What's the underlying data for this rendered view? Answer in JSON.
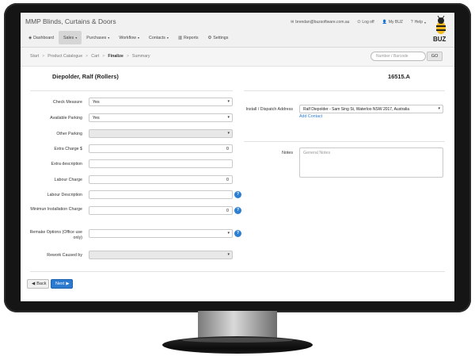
{
  "app": {
    "brand": "MMP Blinds, Curtains & Doors",
    "logo_text": "BUZ"
  },
  "userlinks": [
    {
      "icon": "email-icon",
      "label": "brendan@buzsoftware.com.au"
    },
    {
      "icon": "power-icon",
      "label": "Log off"
    },
    {
      "icon": "user-icon",
      "label": "My BUZ"
    },
    {
      "icon": "question-icon",
      "label": "Help"
    }
  ],
  "nav": [
    {
      "icon": "dashboard-icon",
      "label": "Dashboard",
      "caret": false
    },
    {
      "icon": "",
      "label": "Sales",
      "caret": true
    },
    {
      "icon": "",
      "label": "Purchases",
      "caret": true
    },
    {
      "icon": "",
      "label": "Workflow",
      "caret": true
    },
    {
      "icon": "",
      "label": "Contacts",
      "caret": true
    },
    {
      "icon": "bar-chart-icon",
      "label": "Reports",
      "caret": false
    },
    {
      "icon": "gears-icon",
      "label": "Settings",
      "caret": false
    }
  ],
  "breadcrumb": [
    "Start",
    "Product Catalogue",
    "Cart",
    "Finalize",
    "Summary"
  ],
  "search": {
    "placeholder": "Number / Barcode",
    "go_label": "GO"
  },
  "order": {
    "customer": "Diepolder, Ralf (Rollers)",
    "number": "16515.A"
  },
  "form": {
    "check_measure": {
      "label": "Check Measure",
      "value": "Yes"
    },
    "available_parking": {
      "label": "Available Parking",
      "value": "Yes"
    },
    "other_parking": {
      "label": "Other Parking",
      "value": ""
    },
    "extra_charge": {
      "label": "Extra Charge $",
      "value": "0"
    },
    "extra_description": {
      "label": "Extra description",
      "value": ""
    },
    "labour_charge": {
      "label": "Labour Charge",
      "value": "0"
    },
    "labour_description": {
      "label": "Labour Description",
      "value": ""
    },
    "min_installation_charge": {
      "label": "Minimun Installation Charge",
      "value": "0"
    },
    "remake_options": {
      "label": "Remake Options (Office use only)",
      "value": ""
    },
    "rework_caused_by": {
      "label": "Rework Caused by",
      "value": ""
    },
    "install_address": {
      "label": "Install / Dispatch Address",
      "value": "Ralf Diepolder - Sam Sing St, Waterloo NSW 2017, Australia"
    },
    "add_contact": "Add Contact",
    "notes": {
      "label": "Notes",
      "placeholder": "General Notes"
    }
  },
  "buttons": {
    "back": "Back",
    "next": "Next"
  },
  "colors": {
    "primary": "#2b7ad0",
    "bezel": "#151515"
  }
}
